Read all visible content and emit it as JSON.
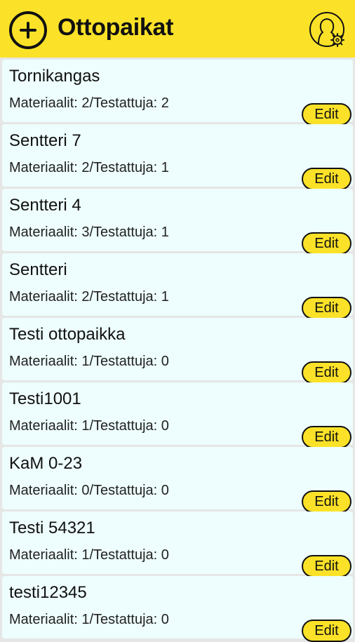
{
  "header": {
    "title": "Ottopaikat",
    "add_icon": "plus-circle-icon",
    "profile_icon": "user-settings-icon"
  },
  "colors": {
    "header_bg": "#fbe228",
    "card_bg": "#eefdfd",
    "edit_button_bg": "#fbe228"
  },
  "edit_label": "Edit",
  "items": [
    {
      "name": "Tornikangas",
      "stats": "Materiaalit: 2/Testattuja: 2"
    },
    {
      "name": "Sentteri 7",
      "stats": "Materiaalit: 2/Testattuja: 1"
    },
    {
      "name": "Sentteri 4",
      "stats": "Materiaalit: 3/Testattuja: 1"
    },
    {
      "name": "Sentteri",
      "stats": "Materiaalit: 2/Testattuja: 1"
    },
    {
      "name": "Testi ottopaikka",
      "stats": "Materiaalit: 1/Testattuja: 0"
    },
    {
      "name": "Testi1001",
      "stats": "Materiaalit: 1/Testattuja: 0"
    },
    {
      "name": "KaM 0-23",
      "stats": "Materiaalit: 0/Testattuja: 0"
    },
    {
      "name": "Testi 54321",
      "stats": "Materiaalit: 1/Testattuja: 0"
    },
    {
      "name": "testi12345",
      "stats": "Materiaalit: 1/Testattuja: 0"
    }
  ]
}
